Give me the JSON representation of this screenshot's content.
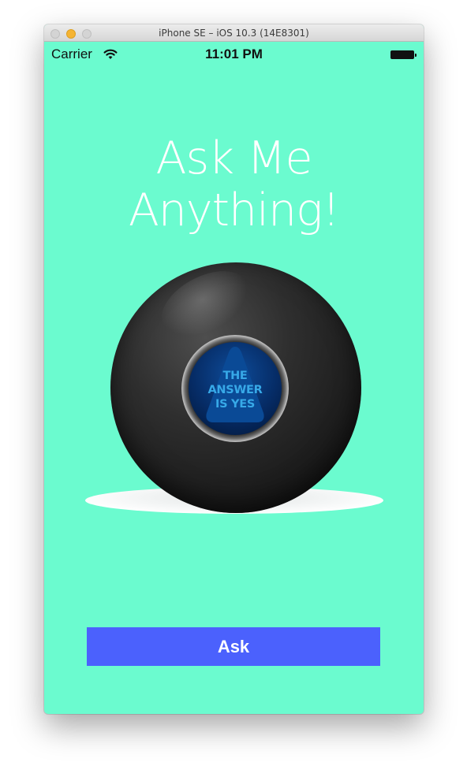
{
  "window": {
    "title": "iPhone SE – iOS 10.3 (14E8301)"
  },
  "status_bar": {
    "carrier": "Carrier",
    "time": "11:01 PM",
    "wifi_icon": "wifi-icon",
    "battery_icon": "battery-icon"
  },
  "main": {
    "headline": "Ask Me Anything!",
    "ball": {
      "answer_lines": [
        "THE",
        "ANSWER",
        "IS YES"
      ]
    },
    "ask_button_label": "Ask"
  },
  "colors": {
    "background": "#6bfbcf",
    "button": "#4b61fd",
    "answer_text": "#37a9e8",
    "answer_panel": "#0a4a96"
  }
}
